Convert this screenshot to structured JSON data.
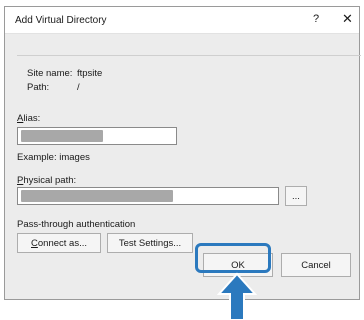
{
  "dialog": {
    "title": "Add Virtual Directory",
    "help_label": "?",
    "close_label": "✕"
  },
  "site": {
    "name_label": "Site name:",
    "name_value": "ftpsite",
    "path_label": "Path:",
    "path_value": "/"
  },
  "alias": {
    "label_first": "A",
    "label_rest": "lias:",
    "value": "",
    "example": "Example: images"
  },
  "physical_path": {
    "label_first": "P",
    "label_rest": "hysical path:",
    "value": "",
    "browse_label": "..."
  },
  "auth": {
    "label": "Pass-through authentication",
    "connect_first": "C",
    "connect_rest": "onnect as...",
    "test_label": "Test Settings..."
  },
  "actions": {
    "ok_label": "OK",
    "cancel_label": "Cancel"
  },
  "colors": {
    "highlight": "#2b79be",
    "dialog_bg": "#ececec"
  }
}
